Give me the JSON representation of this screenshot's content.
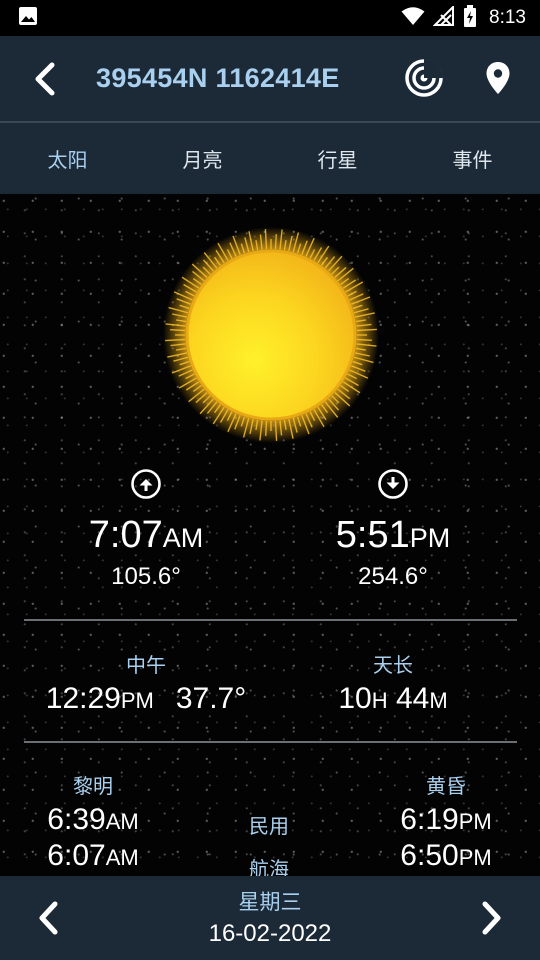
{
  "status_bar": {
    "time": "8:13"
  },
  "app_bar": {
    "title": "395454N 1162414E",
    "back_icon": "chevron-left-icon",
    "actions": [
      "radar-icon",
      "location-pin-icon"
    ]
  },
  "tabs": [
    {
      "label": "太阳",
      "active": true
    },
    {
      "label": "月亮",
      "active": false
    },
    {
      "label": "行星",
      "active": false
    },
    {
      "label": "事件",
      "active": false
    }
  ],
  "sunrise": {
    "time": "7:07",
    "suffix": "AM",
    "azimuth": "105.6°"
  },
  "sunset": {
    "time": "5:51",
    "suffix": "PM",
    "azimuth": "254.6°"
  },
  "noon": {
    "label": "中午",
    "time": "12:29",
    "suffix": "PM",
    "altitude": "37.7°"
  },
  "day_length": {
    "label": "天长",
    "hours": "10",
    "hours_unit": "H",
    "minutes": "44",
    "minutes_unit": "M"
  },
  "twilight": {
    "dawn_label": "黎明",
    "dusk_label": "黄昏",
    "civil": {
      "label": "民用",
      "dawn": "6:39",
      "dawn_suffix": "AM",
      "dusk": "6:19",
      "dusk_suffix": "PM"
    },
    "nautical": {
      "label": "航海",
      "dawn": "6:07",
      "dawn_suffix": "AM",
      "dusk": "6:50",
      "dusk_suffix": "PM"
    }
  },
  "bottom_bar": {
    "weekday": "星期三",
    "date": "16-02-2022"
  },
  "colors": {
    "bar_bg": "#1c2a38",
    "accent": "#a9d0ef",
    "sun": "#f7c21c"
  }
}
